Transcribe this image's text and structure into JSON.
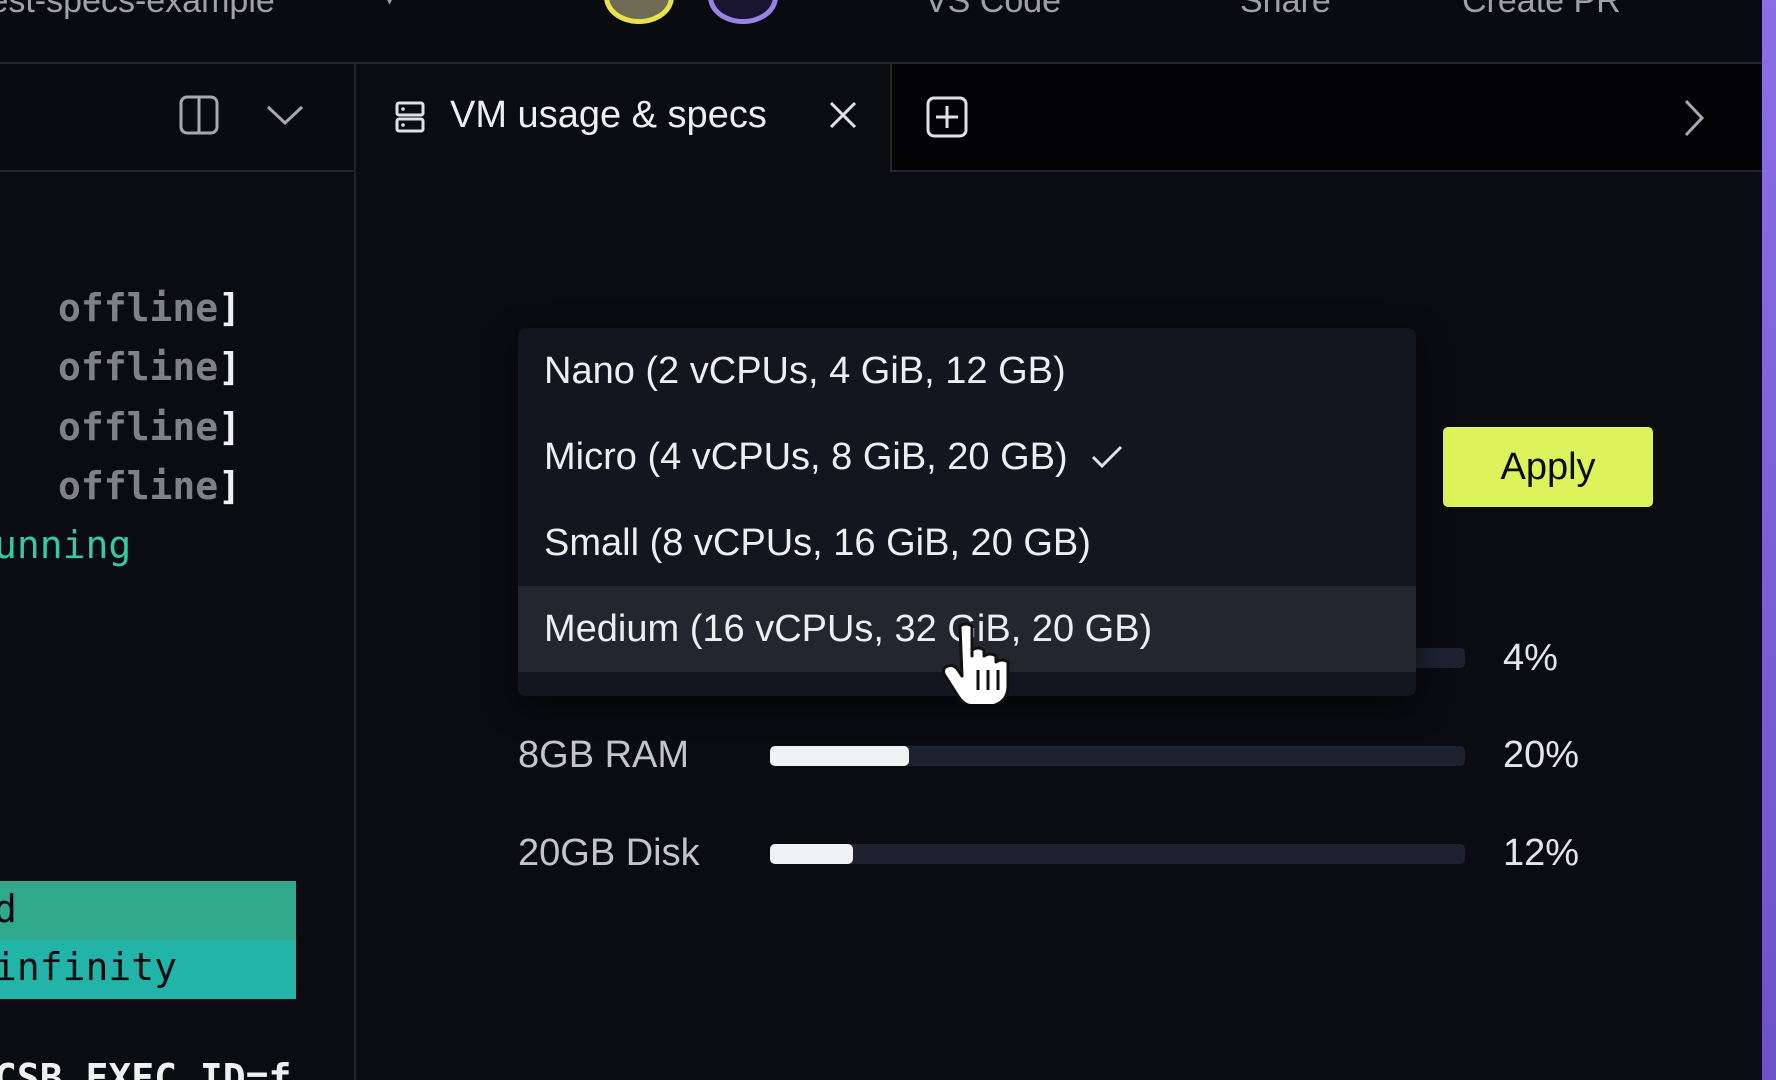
{
  "topbar": {
    "project_name": "test-specs-example",
    "vs_code_label": "VS Code",
    "share_label": "Share",
    "create_pr_label": "Create PR"
  },
  "terminal": {
    "lines": [
      {
        "word": "offline",
        "bracket": "]"
      },
      {
        "word": "offline",
        "bracket": "]"
      },
      {
        "word": "offline",
        "bracket": "]"
      },
      {
        "word": "offline",
        "bracket": "]"
      }
    ],
    "running": "unning",
    "highlight_lines": [
      "d",
      "infinity"
    ],
    "bottom_line": "CSB_EXEC_ID=f"
  },
  "tab": {
    "label": "VM usage & specs",
    "icon": "server-icon"
  },
  "dropdown": {
    "items": [
      {
        "label": "Nano (2 vCPUs, 4 GiB, 12 GB)",
        "selected": false
      },
      {
        "label": "Micro (4 vCPUs, 8 GiB, 20 GB)",
        "selected": true
      },
      {
        "label": "Small (8 vCPUs, 16 GiB, 20 GB)",
        "selected": false
      },
      {
        "label": "Medium (16 vCPUs, 32 GiB, 20 GB)",
        "selected": false,
        "hovered": true
      }
    ]
  },
  "apply_button": {
    "label": "Apply"
  },
  "usage": [
    {
      "label": "",
      "percent": 4,
      "percent_text": "4%"
    },
    {
      "label": "8GB RAM",
      "percent": 20,
      "percent_text": "20%"
    },
    {
      "label": "20GB Disk",
      "percent": 12,
      "percent_text": "12%"
    }
  ],
  "colors": {
    "accent": "#dcf35c",
    "background": "#0b0c12",
    "terminal_green": "#37c9a4",
    "highlight_teal": "#22b3a9"
  }
}
